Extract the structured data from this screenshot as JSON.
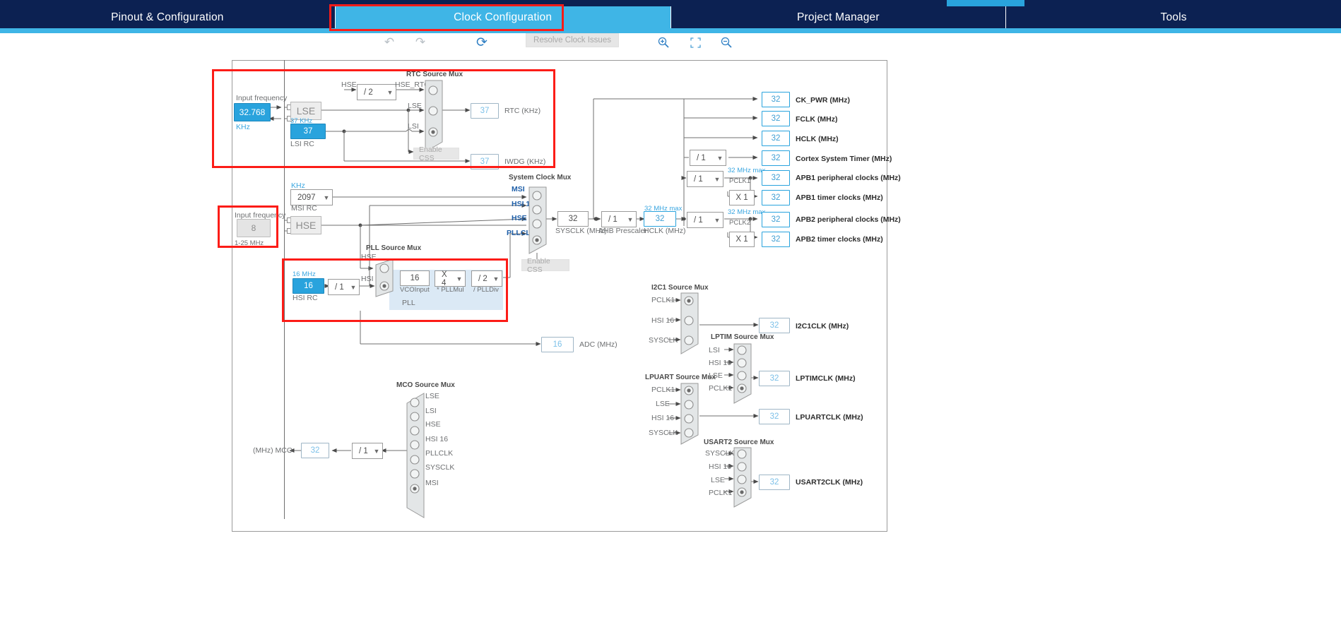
{
  "window": {
    "top_strip_labels": [
      "",
      "",
      ""
    ]
  },
  "tabs": [
    {
      "label": "Pinout & Configuration",
      "active": false
    },
    {
      "label": "Clock Configuration",
      "active": true
    },
    {
      "label": "Project Manager",
      "active": false
    },
    {
      "label": "Tools",
      "active": false
    }
  ],
  "toolbar": {
    "undo_icon": "undo-icon",
    "redo_icon": "redo-icon",
    "refresh_icon": "refresh-icon",
    "resolve_label": "Resolve Clock Issues",
    "zoom_in_icon": "zoom-in-icon",
    "fit_icon": "fit-to-screen-icon",
    "zoom_out_icon": "zoom-out-icon"
  },
  "clock_tree": {
    "lse": {
      "input_frequency_label": "Input frequency",
      "value": "32.768",
      "unit": "KHz",
      "osc_label": "LSE",
      "out_label": "37 KHz"
    },
    "lsi": {
      "value": "37",
      "label": "LSI RC"
    },
    "hse_rtc_div": {
      "in_label": "HSE",
      "value": "/ 2",
      "out_label": "HSE_RTC"
    },
    "rtc_source_mux": {
      "title": "RTC Source Mux",
      "inputs": [
        "HSE_RTC",
        "LSE",
        "LSI"
      ],
      "selected_index": 2
    },
    "rtc_out": {
      "value": "37",
      "label": "RTC (KHz)"
    },
    "iwdg_out": {
      "value": "37",
      "label": "IWDG (KHz)"
    },
    "enable_css_lse": "Enable CSS",
    "msi": {
      "unit": "KHz",
      "value": "2097",
      "label": "MSI RC"
    },
    "hse": {
      "input_frequency_label": "Input frequency",
      "value": "8",
      "range": "1-25 MHz",
      "osc_label": "HSE"
    },
    "hsi": {
      "unit_label": "16 MHz",
      "value": "16",
      "label": "HSI RC",
      "div": "/ 1"
    },
    "pll_source_mux": {
      "title": "PLL Source Mux",
      "inputs": [
        "HSE",
        "HSI 16"
      ],
      "selected_index": 1
    },
    "pll": {
      "vco_input": "16",
      "vco_input_label": "VCOInput",
      "pll_mul": "X 4",
      "pll_mul_label": "* PLLMul",
      "pll_div": "/ 2",
      "pll_div_label": "/ PLLDiv",
      "block_label": "PLL"
    },
    "system_clock_mux": {
      "title": "System Clock Mux",
      "inputs": [
        "MSI",
        "HSI 16",
        "HSE",
        "PLLCLK"
      ],
      "selected_index": 3
    },
    "enable_css_sys": "Enable CSS",
    "sysclk": {
      "value": "32",
      "label": "SYSCLK (MHz)"
    },
    "ahb_prescaler": {
      "value": "/ 1",
      "label": "AHB Prescaler"
    },
    "hclk": {
      "value": "32",
      "label": "HCLK (MHz)"
    },
    "adc": {
      "value": "16",
      "label": "ADC (MHz)"
    },
    "right_outputs": [
      {
        "value": "32",
        "label": "CK_PWR (MHz)"
      },
      {
        "value": "32",
        "label": "FCLK (MHz)"
      },
      {
        "value": "32",
        "label": "HCLK (MHz)"
      }
    ],
    "cortex_timer": {
      "div": "/ 1",
      "value": "32",
      "label": "Cortex System Timer (MHz)"
    },
    "apb1": {
      "max_note": "32 MHz max",
      "div": "/ 1",
      "tag": "PCLK1",
      "periph": {
        "value": "32",
        "label": "APB1 peripheral clocks (MHz)"
      },
      "mult": "X 1",
      "timer": {
        "value": "32",
        "label": "APB1 timer clocks (MHz)"
      }
    },
    "apb2": {
      "max_note": "32 MHz max",
      "div": "/ 1",
      "tag": "PCLK2",
      "periph": {
        "value": "32",
        "label": "APB2 peripheral clocks (MHz)"
      },
      "mult": "X 1",
      "timer": {
        "value": "32",
        "label": "APB2 timer clocks (MHz)"
      }
    },
    "hclk_note": "32 MHz max",
    "mco": {
      "title": "MCO Source Mux",
      "inputs": [
        "LSE",
        "LSI",
        "HSE",
        "HSI 16",
        "PLLCLK",
        "SYSCLK",
        "MSI"
      ],
      "selected_index": 6,
      "div": "/ 1",
      "value": "32",
      "label": "(MHz) MCO"
    },
    "i2c1": {
      "title": "I2C1 Source Mux",
      "inputs": [
        "PCLK1",
        "HSI 16",
        "SYSCLK"
      ],
      "selected_index": 0,
      "out": {
        "value": "32",
        "label": "I2C1CLK (MHz)"
      }
    },
    "lpuart": {
      "title": "LPUART Source Mux",
      "inputs": [
        "PCLK1",
        "LSE",
        "HSI 16",
        "SYSCLK"
      ],
      "selected_index": 0,
      "out": {
        "value": "32",
        "label": "LPUARTCLK (MHz)"
      }
    },
    "lptim": {
      "title": "LPTIM Source Mux",
      "inputs": [
        "LSI",
        "HSI 16",
        "LSE",
        "PCLK1"
      ],
      "selected_index": 3,
      "out": {
        "value": "32",
        "label": "LPTIMCLK (MHz)"
      }
    },
    "usart2": {
      "title": "USART2 Source Mux",
      "inputs": [
        "SYSCLK",
        "HSI 16",
        "LSE",
        "PCLK1"
      ],
      "selected_index": 3,
      "out": {
        "value": "32",
        "label": "USART2CLK (MHz)"
      }
    }
  },
  "colors": {
    "navy": "#0c2152",
    "accent_blue": "#3fb5e6",
    "selected_blue": "#29a3dd",
    "highlight_red": "#fc1c17",
    "wire_gray": "#6f6f6f"
  }
}
